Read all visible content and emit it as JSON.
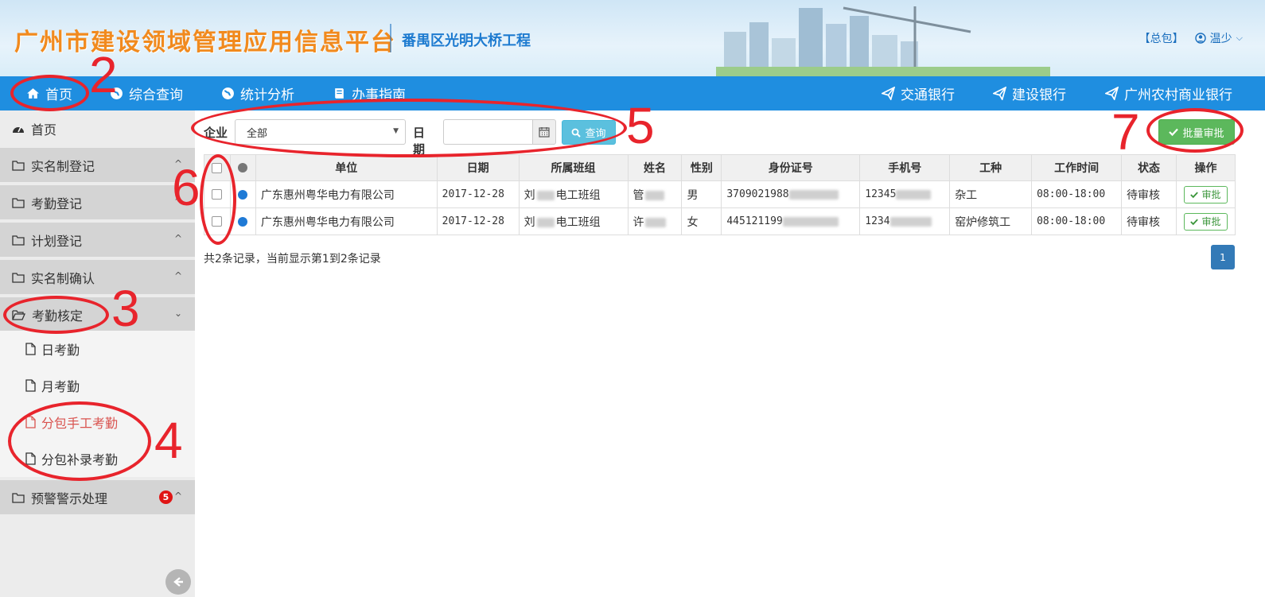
{
  "header": {
    "title": "广州市建设领域管理应用信息平台",
    "project": "番禺区光明大桥工程",
    "general_contract": "【总包】",
    "user": "温少",
    "user_caret": "⌵"
  },
  "nav": {
    "left": [
      {
        "label": "首页",
        "icon": "home-icon"
      },
      {
        "label": "综合查询",
        "icon": "globe-icon"
      },
      {
        "label": "统计分析",
        "icon": "globe-icon"
      },
      {
        "label": "办事指南",
        "icon": "book-icon"
      }
    ],
    "right": [
      {
        "label": "交通银行",
        "icon": "send-icon"
      },
      {
        "label": "建设银行",
        "icon": "send-icon"
      },
      {
        "label": "广州农村商业银行",
        "icon": "send-icon"
      }
    ]
  },
  "sidebar": {
    "home": "首页",
    "items": [
      {
        "label": "实名制登记",
        "caret": "^"
      },
      {
        "label": "考勤登记",
        "caret": "^"
      },
      {
        "label": "计划登记",
        "caret": "^"
      },
      {
        "label": "实名制确认",
        "caret": "^"
      },
      {
        "label": "考勤核定",
        "caret": "⌄"
      }
    ],
    "sub_items": [
      {
        "label": "日考勤"
      },
      {
        "label": "月考勤"
      },
      {
        "label": "分包手工考勤",
        "active": true
      },
      {
        "label": "分包补录考勤"
      }
    ],
    "warning": {
      "label": "预警警示处理",
      "badge": "5",
      "caret": "^"
    }
  },
  "filter": {
    "company_label": "企业",
    "company_value": "全部",
    "date_label": "日期",
    "date_value": "",
    "query_button": "查询",
    "batch_button": "批量审批"
  },
  "table": {
    "headers": [
      "单位",
      "日期",
      "所属班组",
      "姓名",
      "性别",
      "身份证号",
      "手机号",
      "工种",
      "工作时间",
      "状态",
      "操作"
    ],
    "rows": [
      {
        "company": "广东惠州粤华电力有限公司",
        "date": "2017-12-28",
        "team_prefix": "刘",
        "team_suffix": "电工班组",
        "name": "管",
        "gender": "男",
        "id_number": "3709021988",
        "phone": "12345",
        "job": "杂工",
        "work_time": "08:00-18:00",
        "status": "待审核",
        "action": "审批"
      },
      {
        "company": "广东惠州粤华电力有限公司",
        "date": "2017-12-28",
        "team_prefix": "刘",
        "team_suffix": "电工班组",
        "name": "许",
        "gender": "女",
        "id_number": "445121199",
        "phone": "1234",
        "job": "窑炉修筑工",
        "work_time": "08:00-18:00",
        "status": "待审核",
        "action": "审批"
      }
    ]
  },
  "footer": {
    "info": "共2条记录，当前显示第1到2条记录",
    "page": "1"
  },
  "annotations": [
    "2",
    "3",
    "4",
    "5",
    "6",
    "7"
  ],
  "colors": {
    "nav_bg": "#1f8ee0",
    "title": "#f18a1e",
    "annotation": "#e8242c",
    "success": "#5cb85c",
    "info": "#5bc0de"
  }
}
